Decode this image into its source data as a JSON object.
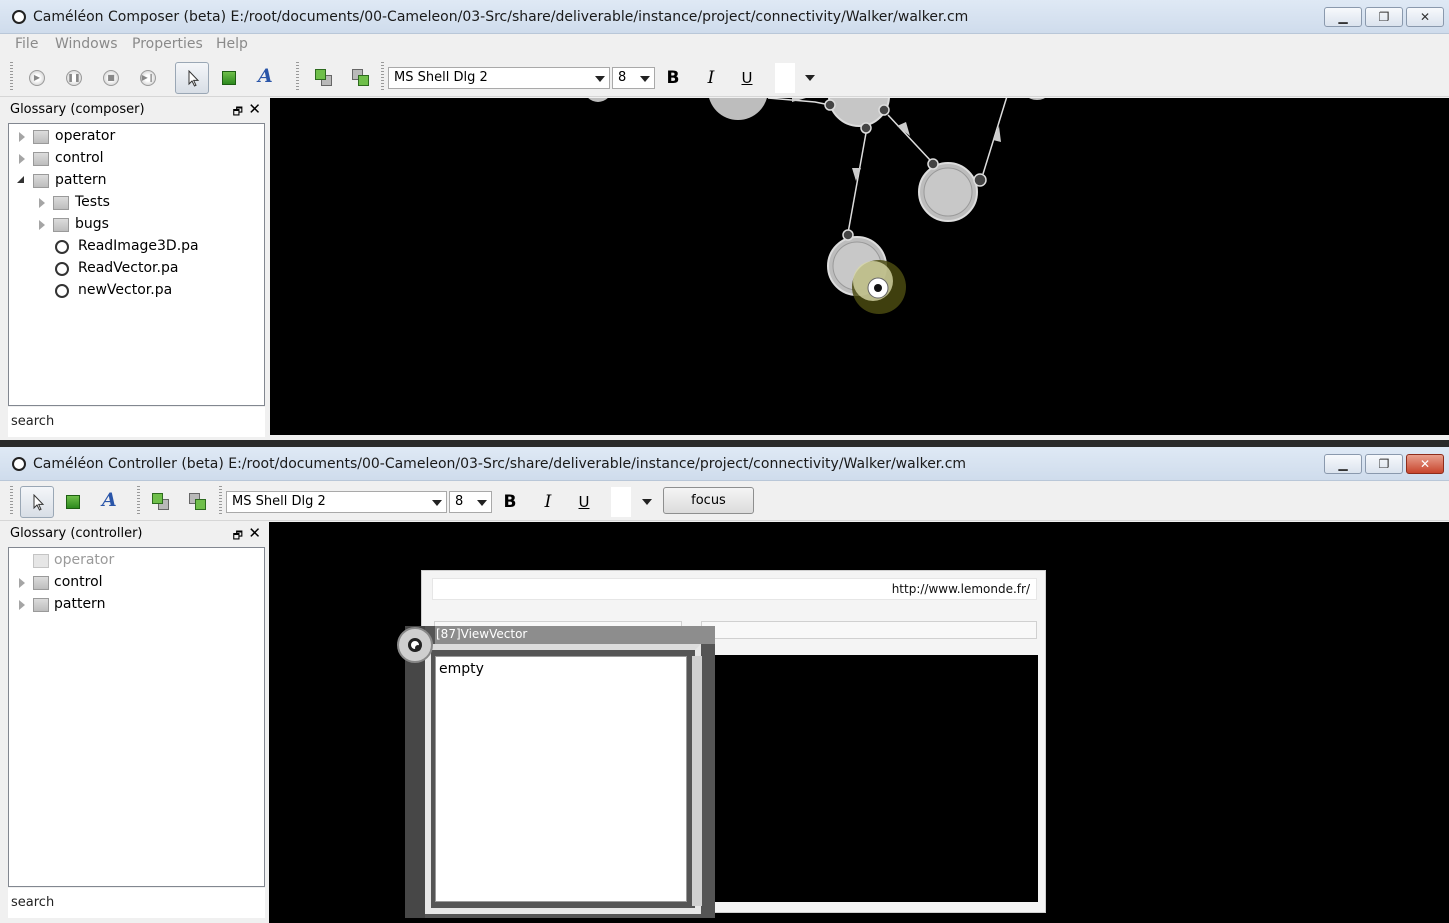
{
  "composer": {
    "title": "Caméléon Composer (beta) E:/root/documents/00-Cameleon/03-Src/share/deliverable/instance/project/connectivity/Walker/walker.cm",
    "menu": [
      "File",
      "Windows",
      "Properties",
      "Help"
    ],
    "toolbar": {
      "font": "MS Shell Dlg 2",
      "size": "8",
      "bold": "B",
      "italic": "I",
      "underline": "U"
    },
    "glossary": {
      "title": "Glossary (composer)",
      "items": [
        {
          "label": "operator",
          "kind": "folder",
          "expanded": false
        },
        {
          "label": "control",
          "kind": "folder",
          "expanded": false
        },
        {
          "label": "pattern",
          "kind": "folder",
          "expanded": true
        },
        {
          "label": "Tests",
          "kind": "folder",
          "expanded": false
        },
        {
          "label": "bugs",
          "kind": "folder",
          "expanded": false
        },
        {
          "label": "ReadImage3D.pa",
          "kind": "file"
        },
        {
          "label": "ReadVector.pa",
          "kind": "file"
        },
        {
          "label": "newVector.pa",
          "kind": "file"
        }
      ],
      "search": "search"
    }
  },
  "controller": {
    "title": "Caméléon Controller (beta) E:/root/documents/00-Cameleon/03-Src/share/deliverable/instance/project/connectivity/Walker/walker.cm",
    "toolbar": {
      "font": "MS Shell Dlg 2",
      "size": "8",
      "bold": "B",
      "italic": "I",
      "underline": "U",
      "focus": "focus"
    },
    "glossary": {
      "title": "Glossary (controller)",
      "items": [
        {
          "label": "operator",
          "kind": "folder",
          "disabled": true
        },
        {
          "label": "control",
          "kind": "folder"
        },
        {
          "label": "pattern",
          "kind": "folder"
        }
      ],
      "search": "search"
    },
    "panel": {
      "url": "http://www.lemonde.fr/",
      "viewvector_title": "[87]ViewVector",
      "viewvector_value": "empty"
    }
  },
  "icons": {
    "window_icon": "circle-icon",
    "minimize": "minimize-icon",
    "maximize": "maximize-icon",
    "close": "close-icon"
  }
}
